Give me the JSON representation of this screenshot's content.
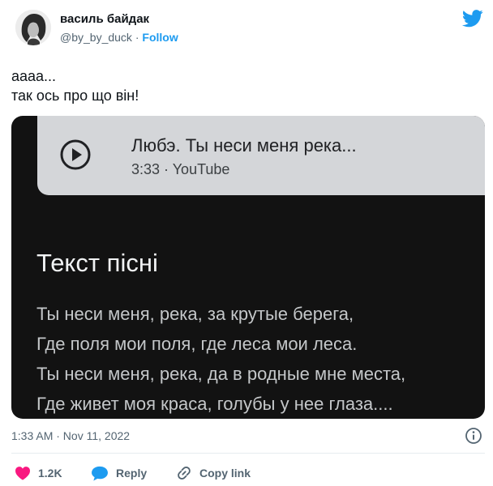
{
  "tweet": {
    "author": {
      "name": "василь байдак",
      "handle": "@by_by_duck",
      "separator": " · ",
      "follow_label": "Follow"
    },
    "text_lines": [
      "аааа...",
      "так ось про що він!"
    ],
    "timestamp": "1:33 AM · Nov 11, 2022",
    "actions": {
      "likes": "1.2K",
      "reply": "Reply",
      "copy_link": "Copy link"
    }
  },
  "media": {
    "song_title": "Любэ. Ты неси меня река...",
    "song_meta": "3:33 · YouTube",
    "lyrics_heading": "Текст пісні",
    "lyrics_lines": [
      "Ты неси меня, река, за крутые берега,",
      "Где поля мои поля, где леса мои леса.",
      "Ты неси меня, река, да в родные мне места,",
      "Где живет моя краса, голубы у нее глаза...."
    ]
  },
  "colors": {
    "twitter_blue": "#1d9bf0",
    "like_pink": "#f91880",
    "muted_text": "#536471",
    "media_background": "#121212",
    "card_background": "#d4d6d9"
  },
  "icons": [
    "avatar-portrait",
    "twitter-bird-icon",
    "play-icon",
    "info-icon",
    "heart-icon",
    "reply-bubble-icon",
    "link-icon"
  ]
}
